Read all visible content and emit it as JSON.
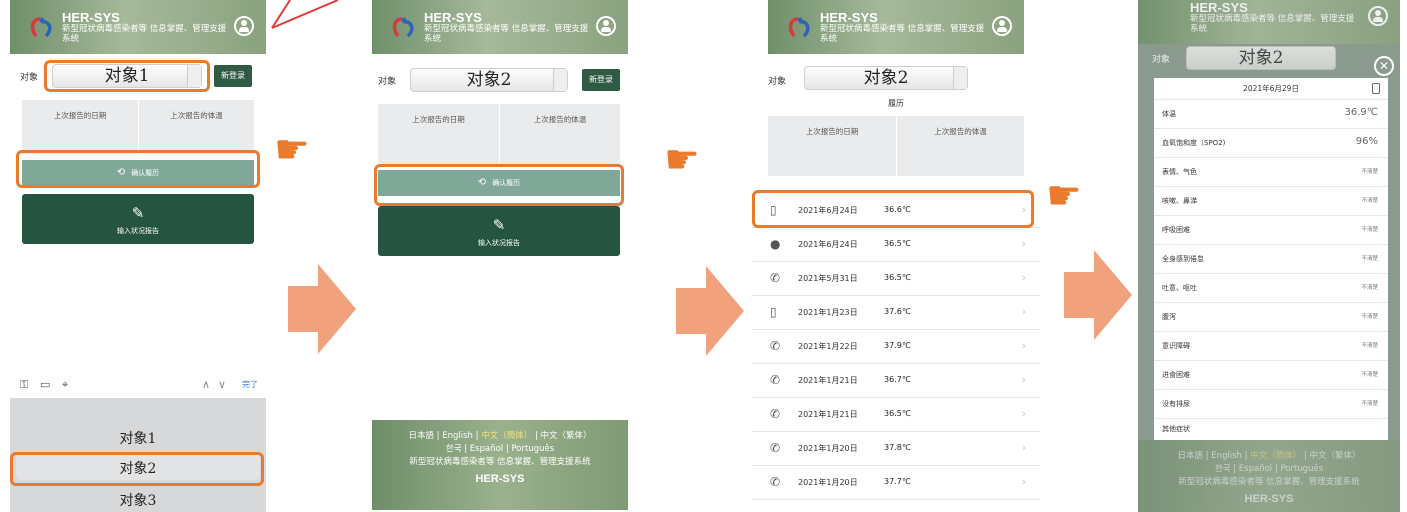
{
  "app": {
    "brand": "HER-SYS",
    "subtitle": "新型冠状病毒感染者等 信息掌握、管理支援系统",
    "subject_label": "对象",
    "new_register": "新登录",
    "last_report_date": "上次报告的日期",
    "last_report_temp": "上次报告的体温",
    "confirm_history": "确认履历",
    "enter_report": "输入状况报告"
  },
  "colors": {
    "accent": "#ea7a2c",
    "header_green": "#8aa27f",
    "button_green": "#255440",
    "history_button": "#7fa898"
  },
  "screen1": {
    "selected_subject": "对象1",
    "keyboard_done": "完了",
    "picker_options": [
      "对象1",
      "对象2",
      "对象3"
    ]
  },
  "screen2": {
    "selected_subject": "对象2",
    "footer": {
      "langs_line1": [
        "日本語",
        "English",
        "中文（簡体）",
        "中文（繁体）"
      ],
      "langs_line2": [
        "한국",
        "Español",
        "Português"
      ],
      "system": "新型冠状病毒感染者等 信息掌握、管理支援系统",
      "brand": "HER-SYS"
    }
  },
  "screen3": {
    "selected_subject": "对象2",
    "title": "履历",
    "rows": [
      {
        "icon": "phone-device-icon",
        "date": "2021年6月24日",
        "temp": "36.6℃"
      },
      {
        "icon": "person-icon",
        "date": "2021年6月24日",
        "temp": "36.5℃"
      },
      {
        "icon": "telephone-icon",
        "date": "2021年5月31日",
        "temp": "36.5℃"
      },
      {
        "icon": "phone-device-icon",
        "date": "2021年1月23日",
        "temp": "37.6℃"
      },
      {
        "icon": "telephone-icon",
        "date": "2021年1月22日",
        "temp": "37.9℃"
      },
      {
        "icon": "telephone-icon",
        "date": "2021年1月21日",
        "temp": "36.7℃"
      },
      {
        "icon": "telephone-icon",
        "date": "2021年1月21日",
        "temp": "36.5℃"
      },
      {
        "icon": "telephone-icon",
        "date": "2021年1月20日",
        "temp": "37.8℃"
      },
      {
        "icon": "telephone-icon",
        "date": "2021年1月20日",
        "temp": "37.7℃"
      }
    ]
  },
  "screen4": {
    "selected_subject": "对象2",
    "date": "2021年6月29日",
    "rows": [
      {
        "label": "体温",
        "value": "36.9℃"
      },
      {
        "label": "血氧饱和度（SPO2)",
        "value": "96%"
      },
      {
        "label": "表情、气色",
        "value": "不清楚"
      },
      {
        "label": "咳嗽、鼻涕",
        "value": "不清楚"
      },
      {
        "label": "呼吸困难",
        "value": "不清楚"
      },
      {
        "label": "全身感到倦怠",
        "value": "不清楚"
      },
      {
        "label": "吐意、呕吐",
        "value": "不清楚"
      },
      {
        "label": "腹泻",
        "value": "不清楚"
      },
      {
        "label": "意识障碍",
        "value": "不清楚"
      },
      {
        "label": "进食困难",
        "value": "不清楚"
      },
      {
        "label": "没有排尿",
        "value": "不清楚"
      }
    ],
    "other": "其他症状"
  }
}
